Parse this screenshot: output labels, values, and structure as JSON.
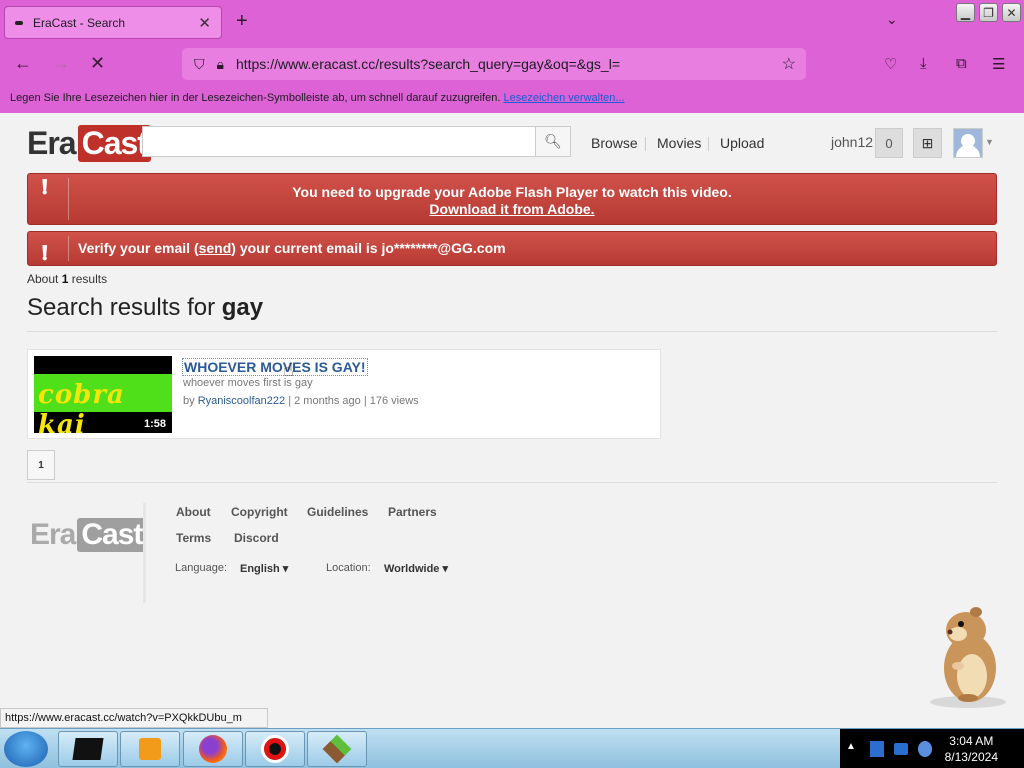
{
  "browser": {
    "tab_title": "EraCast - Search",
    "url": "https://www.eracast.cc/results?search_query=gay&oq=&gs_l=",
    "bookmarks_text": "Legen Sie Ihre Lesezeichen hier in der Lesezeichen-Symbolleiste ab, um schnell darauf zuzugreifen.",
    "bookmarks_link": "Lesezeichen verwalten...",
    "status_url": "https://www.eracast.cc/watch?v=PXQkkDUbu_m"
  },
  "site": {
    "logo_era": "Era",
    "logo_cast": "Cast",
    "nav": [
      "Browse",
      "Movies",
      "Upload"
    ],
    "username": "john12",
    "notif_count": "0"
  },
  "alerts": {
    "flash_line1": "You need to upgrade your Adobe Flash Player to watch this video.",
    "flash_line2": "Download it from Adobe.",
    "verify_prefix": "Verify your email (",
    "verify_link": "send",
    "verify_suffix": ") your current email is jo********@GG.com"
  },
  "results": {
    "about_prefix": "About",
    "about_count": "1",
    "about_suffix": "results",
    "heading_prefix": "Search results for",
    "query": "gay",
    "items": [
      {
        "title": "WHOEVER MOVES IS GAY!",
        "description": "whoever moves first is gay",
        "by": "by",
        "author": "Ryaniscoolfan222",
        "meta": "| 2 months ago | 176 views",
        "duration": "1:58",
        "thumb_text": "cobra kai"
      }
    ],
    "page": "1"
  },
  "footer": {
    "logo_era": "Era",
    "logo_cast": "Cast",
    "links": [
      "About",
      "Copyright",
      "Guidelines",
      "Partners",
      "Terms",
      "Discord"
    ],
    "language_label": "Language:",
    "language_value": "English",
    "location_label": "Location:",
    "location_value": "Worldwide"
  },
  "taskbar": {
    "time": "3:04 AM",
    "date": "8/13/2024"
  }
}
